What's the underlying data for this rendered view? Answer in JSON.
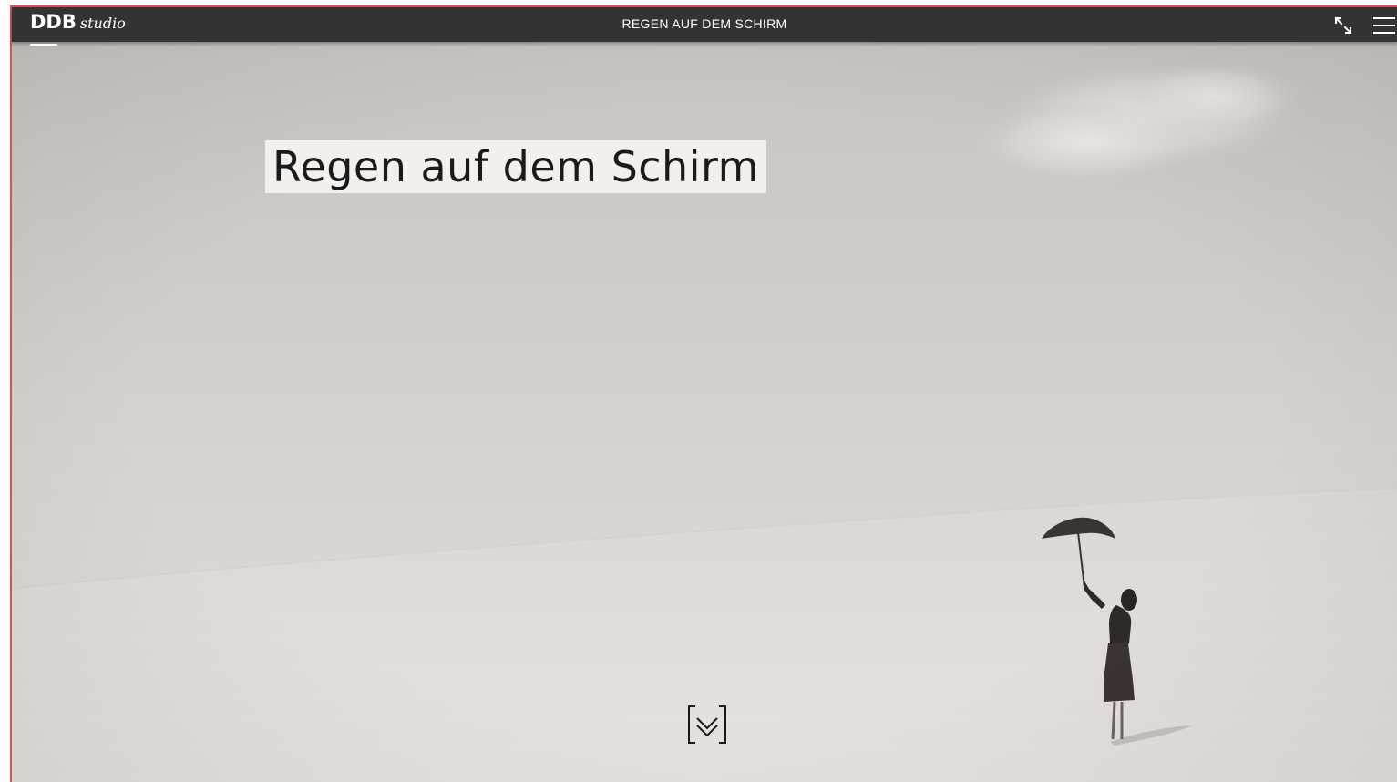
{
  "header": {
    "logo_main": "DDB",
    "logo_sub": "studio",
    "title": "REGEN AUF DEM SCHIRM"
  },
  "hero": {
    "headline": "Regen auf dem Schirm"
  },
  "icons": {
    "fullscreen": "expand-arrows-icon",
    "menu": "hamburger-menu-icon",
    "scroll": "double-chevron-down-icon"
  },
  "colors": {
    "topbar": "#333333",
    "accent_border": "#d9534f",
    "headline_bg": "#f2efed"
  }
}
